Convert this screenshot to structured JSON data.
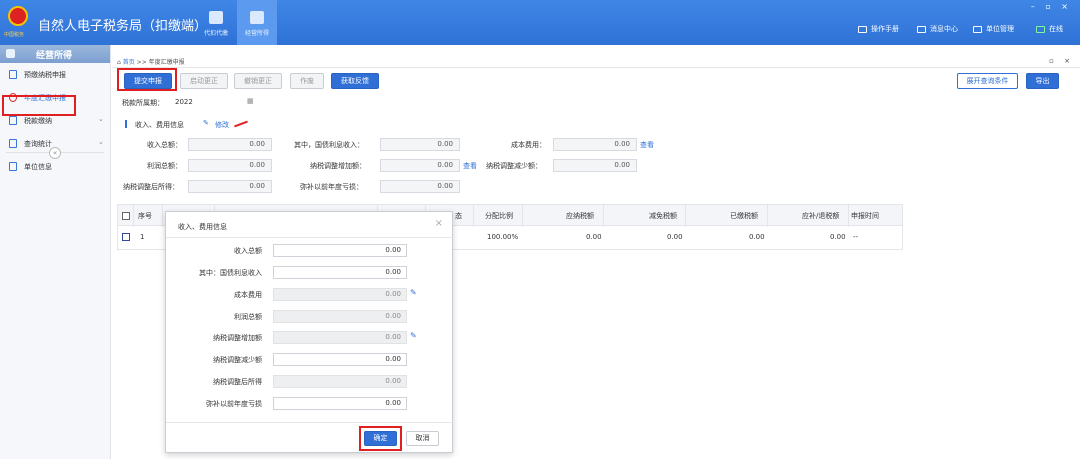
{
  "app": {
    "title": "自然人电子税务局（扣缴端）",
    "emblem_text": "中国税务"
  },
  "topnav": [
    {
      "label": "代扣代缴"
    },
    {
      "label": "经营所得"
    }
  ],
  "toplinks": [
    {
      "label": "操作手册"
    },
    {
      "label": "消息中心"
    },
    {
      "label": "单位管理"
    },
    {
      "label": "在线"
    }
  ],
  "window_controls": "– ▫ ×",
  "sidebar": {
    "title": "经营所得",
    "items": [
      {
        "label": "预缴纳税申报"
      },
      {
        "label": "年度汇缴申报"
      },
      {
        "label": "税款缴纳",
        "chevron": "⌄"
      },
      {
        "label": "查询统计",
        "chevron": "⌄"
      },
      {
        "label": "单位信息"
      }
    ],
    "collapse": "«"
  },
  "breadcrumb": {
    "home": "首页",
    "sep": ">>",
    "current": "年度汇缴申报"
  },
  "pane_controls": "▫ ×",
  "toolbar": {
    "submit": "提交申报",
    "start_correct": "启动更正",
    "cancel_correct": "撤销更正",
    "void": "作废",
    "get_feedback": "获取反馈",
    "expand_query": "展开查询条件",
    "export": "导出"
  },
  "period": {
    "label": "税款所属期：",
    "value": "2022",
    "calendar": "▦"
  },
  "section": {
    "title": "收入、费用信息",
    "edit_icon": "✎",
    "edit": "修改"
  },
  "summary": {
    "total_income": {
      "label": "收入总额：",
      "value": "0.00"
    },
    "bond_interest": {
      "label": "其中，国债利息收入：",
      "value": "0.00"
    },
    "cost": {
      "label": "成本费用：",
      "value": "0.00",
      "link": "查看"
    },
    "profit": {
      "label": "利润总额：",
      "value": "0.00"
    },
    "adj_increase": {
      "label": "纳税调整增加额：",
      "value": "0.00",
      "link": "查看"
    },
    "adj_decrease": {
      "label": "纳税调整减少额：",
      "value": "0.00"
    },
    "adj_income": {
      "label": "纳税调整后所得：",
      "value": "0.00"
    },
    "prior_loss": {
      "label": "弥补以前年度亏损：",
      "value": "0.00"
    }
  },
  "table": {
    "headers": {
      "seq": "序号",
      "state_partial": "态",
      "ratio": "分配比例",
      "payable": "应纳税额",
      "relief": "减免税额",
      "paid": "已缴税额",
      "refund": "应补/退税额",
      "time": "申报时间"
    },
    "rows": [
      {
        "seq": "1",
        "ratio": "100.00%",
        "payable": "0.00",
        "relief": "0.00",
        "paid": "0.00",
        "refund": "0.00",
        "time": "--"
      }
    ]
  },
  "dialog": {
    "title": "收入、费用信息",
    "close": "×",
    "fields": [
      {
        "label": "收入总额",
        "value": "0.00"
      },
      {
        "label": "其中：国债利息收入",
        "value": "0.00"
      },
      {
        "label": "成本费用",
        "value": "0.00"
      },
      {
        "label": "利润总额",
        "value": "0.00"
      },
      {
        "label": "纳税调整增加额",
        "value": "0.00"
      },
      {
        "label": "纳税调整减少额",
        "value": "0.00"
      },
      {
        "label": "纳税调整后所得",
        "value": "0.00"
      },
      {
        "label": "弥补以前年度亏损",
        "value": "0.00"
      }
    ],
    "ok": "确定",
    "cancel": "取消",
    "edit_icon": "✎"
  }
}
